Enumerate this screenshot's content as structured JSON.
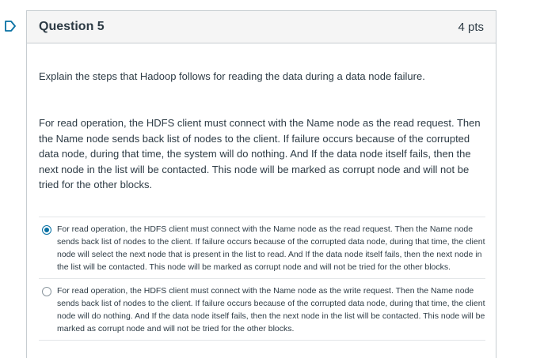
{
  "flag_icon": "bookmark-flag-icon",
  "question": {
    "title": "Question 5",
    "points": "4 pts",
    "prompt": "Explain the steps that Hadoop follows for reading the data during a data node failure.",
    "passage": "For read operation, the HDFS client must connect with the Name node as the read request. Then the Name node sends back list of nodes to the client. If failure occurs because of the corrupted data node, during that time, the system will do nothing. And If the data node itself fails, then the next node in the list will be contacted. This node will be marked as corrupt node and will not be tried for the other blocks."
  },
  "answers": [
    {
      "text": "For read operation, the HDFS client must connect with the Name node as the read request. Then the Name node sends back list of nodes to the client. If failure occurs because of the corrupted data node, during that time, the client node will select the next node that is present in the list to read. And If the data node itself fails, then the next node in the list will be contacted. This node will be marked as corrupt node and will not be tried for the other blocks.",
      "selected": true
    },
    {
      "text": "For read operation, the HDFS client must connect with the Name node as the write request. Then the Name node sends back list of nodes to the client. If failure occurs because of the corrupted data node, during that time, the client node will do nothing. And If the data node itself fails, then the next node in the list will be contacted. This node will be marked as corrupt node and will not be tried for the other blocks.",
      "selected": false
    }
  ],
  "colors": {
    "accent": "#0770a3",
    "text": "#2d3b45",
    "border": "#c7cdd1",
    "header_bg": "#f5f5f5"
  }
}
